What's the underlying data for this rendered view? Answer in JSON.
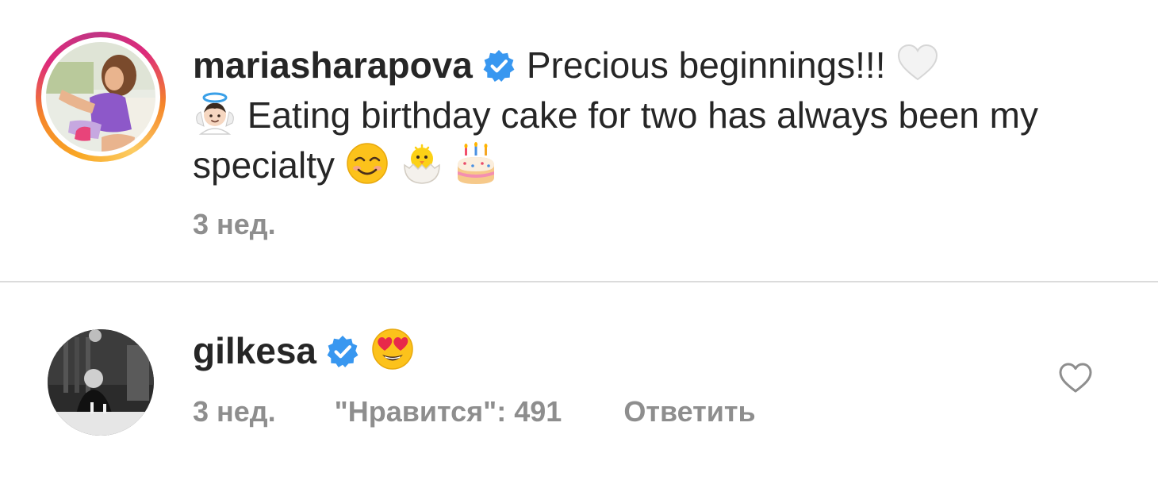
{
  "caption": {
    "username": "mariasharapova",
    "text_part1": "Precious beginnings!!!",
    "text_part2": "Eating birthday cake for two has always been my specialty",
    "timestamp": "3 нед."
  },
  "comment": {
    "username": "gilkesa",
    "timestamp": "3 нед.",
    "likes": "\"Нравится\": 491",
    "reply_label": "Ответить"
  },
  "icons": {
    "verified": "verified-badge-icon",
    "heart_white": "white-heart-emoji",
    "angel": "angel-emoji",
    "smiling": "smiling-face-emoji",
    "chick": "hatching-chick-emoji",
    "cake": "birthday-cake-emoji",
    "heart_eyes": "heart-eyes-emoji",
    "like": "heart-outline-icon"
  },
  "colors": {
    "verified_blue": "#3897f0",
    "secondary_text": "#8e8e8e",
    "primary_text": "#262626",
    "divider": "#dbdbdb"
  }
}
